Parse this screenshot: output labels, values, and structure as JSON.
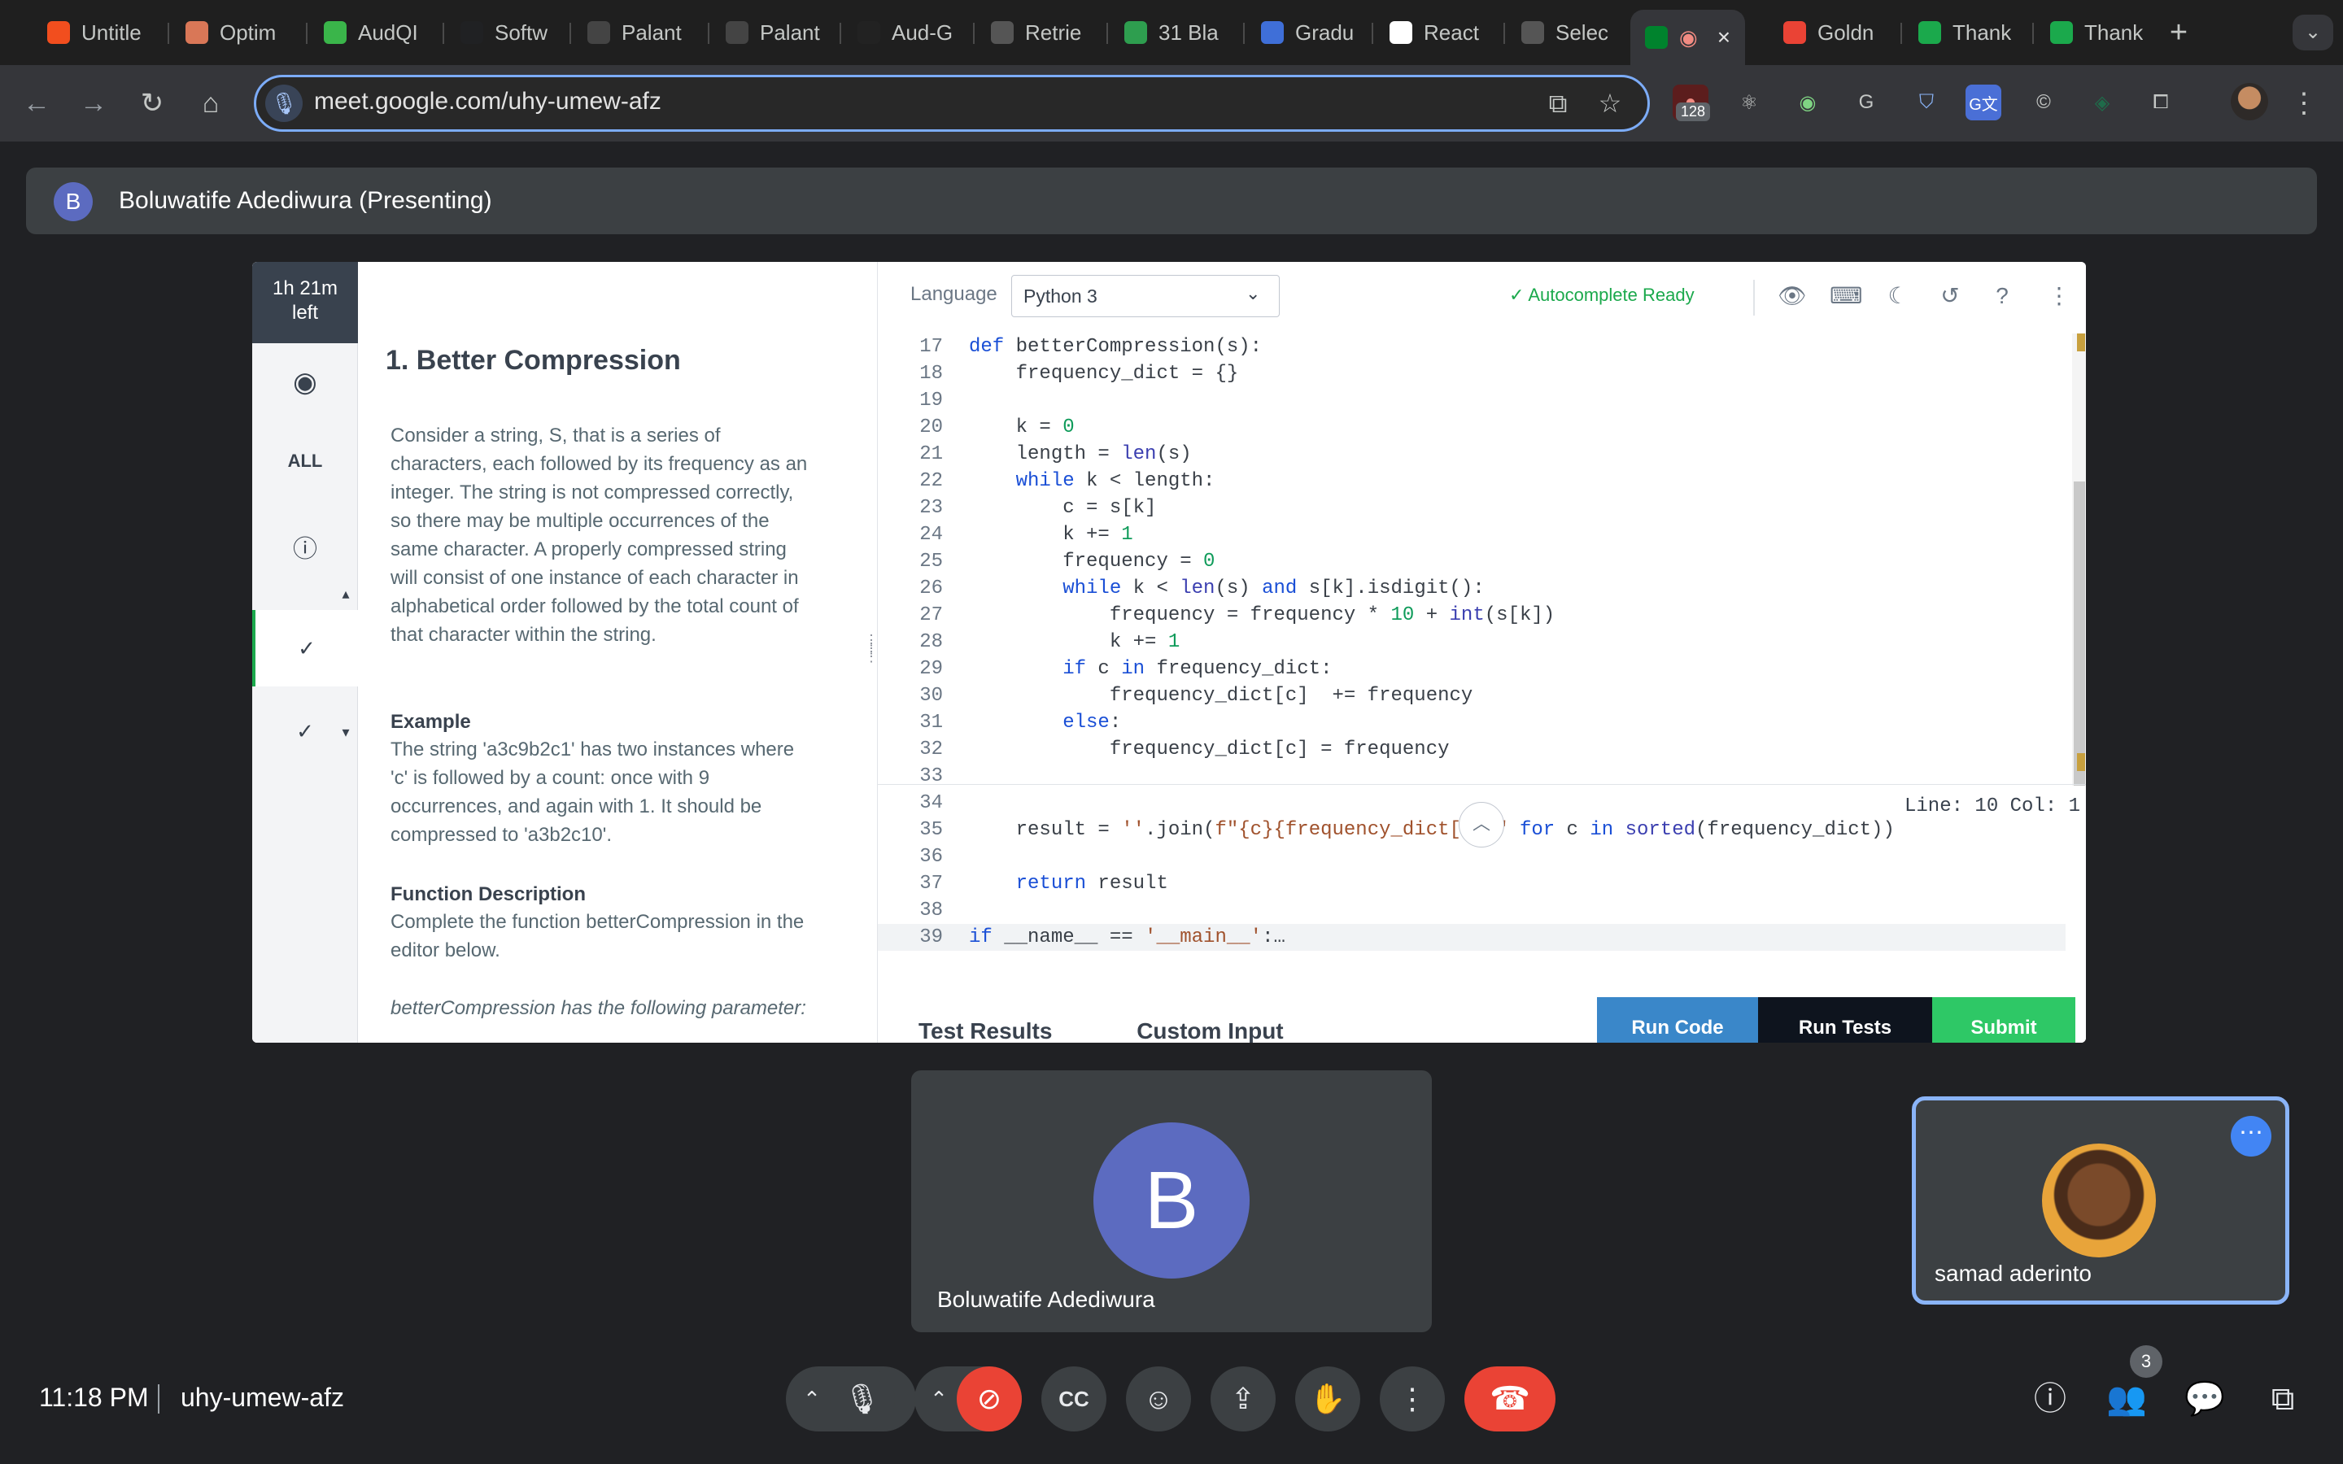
{
  "browser": {
    "tabs": [
      {
        "title": "Untitle",
        "icon": "figma-icon",
        "color": "#f24e1e"
      },
      {
        "title": "Optim",
        "icon": "claude-icon",
        "color": "#d97757"
      },
      {
        "title": "AudQI",
        "icon": "green-circle-icon",
        "color": "#3ab54a"
      },
      {
        "title": "Softw",
        "icon": "openai-icon",
        "color": "#202123"
      },
      {
        "title": "Palant",
        "icon": "palantir-icon",
        "color": "#444"
      },
      {
        "title": "Palant",
        "icon": "palantir-icon",
        "color": "#444"
      },
      {
        "title": "Aud-G",
        "icon": "diamond-icon",
        "color": "#222"
      },
      {
        "title": "Retrie",
        "icon": "globe-icon",
        "color": "#555"
      },
      {
        "title": "31 Bla",
        "icon": "mq-icon",
        "color": "#2e9e4f"
      },
      {
        "title": "Gradu",
        "icon": "grad-icon",
        "color": "#3f6fd8"
      },
      {
        "title": "React",
        "icon": "chatgpt-icon",
        "color": "#fff"
      },
      {
        "title": "Selec",
        "icon": "globe-icon",
        "color": "#555"
      },
      {
        "title": "",
        "icon": "meet-icon",
        "color": "#00832d"
      },
      {
        "title": "Goldn",
        "icon": "gmail-icon",
        "color": "#ea4335"
      },
      {
        "title": "Thank",
        "icon": "hackerrank-icon",
        "color": "#1ba94c"
      },
      {
        "title": "Thank",
        "icon": "hackerrank-icon",
        "color": "#1ba94c"
      }
    ],
    "url": "meet.google.com/uhy-umew-afz",
    "extension_badge": "128"
  },
  "presenter_banner": {
    "avatar_letter": "B",
    "text": "Boluwatife Adediwura (Presenting)"
  },
  "shared_screen": {
    "timer": [
      "1h 21m",
      "left"
    ],
    "sidebar_all": "ALL",
    "problem": {
      "title": "1. Better Compression",
      "paragraphs": [
        "Consider a string, S, that is a series of characters, each followed by its frequency as an integer. The string is not compressed correctly, so there may be multiple occurrences of the same character. A properly compressed string will consist of one instance of each character in alphabetical order followed by the total count of that character within the string.",
        "The string 'a3c9b2c1' has two instances where 'c' is followed by a count: once with 9 occurrences, and again with 1. It should be compressed to 'a3b2c10'.",
        "Complete the function betterCompression in the editor below.",
        "betterCompression has the following parameter:"
      ],
      "example_heading": "Example",
      "function_heading": "Function Description"
    },
    "editor": {
      "language_label": "Language",
      "language": "Python 3",
      "autocomplete": "Autocomplete Ready",
      "code_lines": [
        {
          "n": "17",
          "t": "def betterCompression(s):"
        },
        {
          "n": "18",
          "t": "    frequency_dict = {}"
        },
        {
          "n": "19",
          "t": ""
        },
        {
          "n": "20",
          "t": "    k = 0"
        },
        {
          "n": "21",
          "t": "    length = len(s)"
        },
        {
          "n": "22",
          "t": "    while k < length:"
        },
        {
          "n": "23",
          "t": "        c = s[k]"
        },
        {
          "n": "24",
          "t": "        k += 1"
        },
        {
          "n": "25",
          "t": "        frequency = 0"
        },
        {
          "n": "26",
          "t": "        while k < len(s) and s[k].isdigit():"
        },
        {
          "n": "27",
          "t": "            frequency = frequency * 10 + int(s[k])"
        },
        {
          "n": "28",
          "t": "            k += 1"
        },
        {
          "n": "29",
          "t": "        if c in frequency_dict:"
        },
        {
          "n": "30",
          "t": "            frequency_dict[c]  += frequency"
        },
        {
          "n": "31",
          "t": "        else:"
        },
        {
          "n": "32",
          "t": "            frequency_dict[c] = frequency"
        },
        {
          "n": "33",
          "t": ""
        },
        {
          "n": "34",
          "t": ""
        },
        {
          "n": "35",
          "t": "    result = ''.join(f\"{c}{frequency_dict[c]}\" for c in sorted(frequency_dict))"
        },
        {
          "n": "36",
          "t": ""
        },
        {
          "n": "37",
          "t": "    return result"
        },
        {
          "n": "38",
          "t": ""
        },
        {
          "n": "39",
          "t": "if __name__ == '__main__':…"
        }
      ],
      "status": "Line: 10 Col: 1",
      "bottom_tabs": [
        "Test Results",
        "Custom Input"
      ],
      "buttons": {
        "run_code": "Run Code",
        "run_tests": "Run Tests",
        "submit": "Submit"
      }
    }
  },
  "participants": {
    "main": {
      "letter": "B",
      "name": "Boluwatife Adediwura"
    },
    "self": {
      "name": "samad aderinto"
    }
  },
  "meeting": {
    "time": "11:18 PM",
    "code": "uhy-umew-afz",
    "people_count": "3"
  }
}
